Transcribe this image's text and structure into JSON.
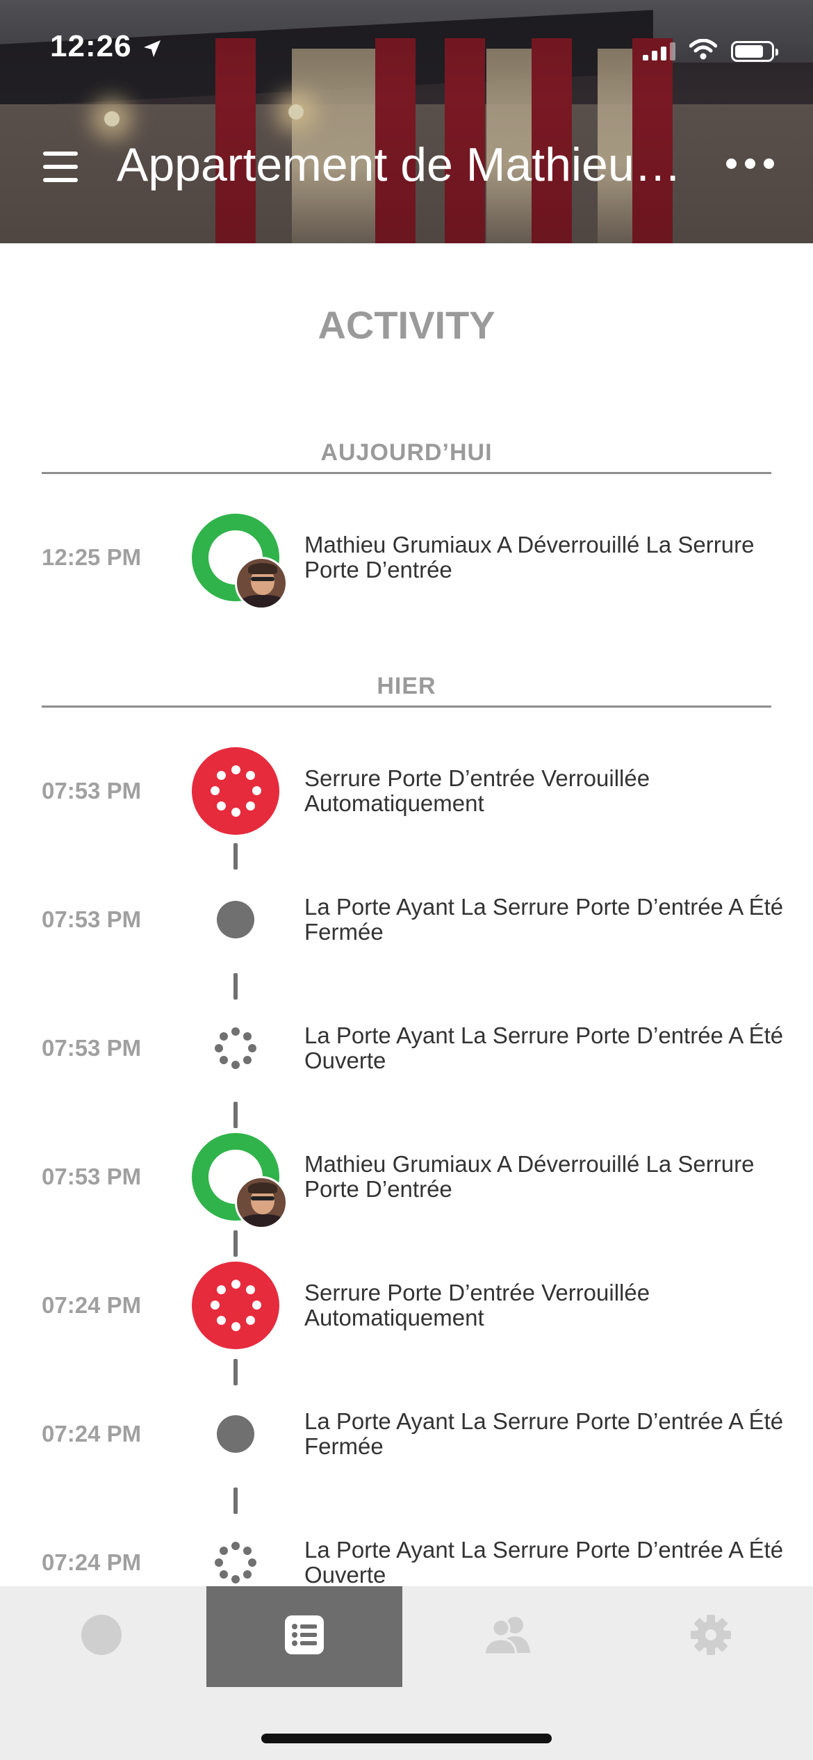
{
  "status_bar": {
    "time": "12:26"
  },
  "header": {
    "title": "Appartement de Mathieu…"
  },
  "page": {
    "title": "ACTIVITY"
  },
  "sections": [
    {
      "label": "AUJOURD’HUI",
      "items": [
        {
          "time": "12:25 PM",
          "icon": "unlock-user-icon",
          "text": "Mathieu Grumiaux A Déverrouillé La Serrure Porte D’entrée"
        }
      ]
    },
    {
      "label": "HIER",
      "items": [
        {
          "time": "07:53 PM",
          "icon": "auto-lock-icon",
          "text": "Serrure Porte D’entrée Verrouillée Automatiquement"
        },
        {
          "time": "07:53 PM",
          "icon": "door-closed-icon",
          "text": "La Porte Ayant La Serrure Porte D’entrée A Été Fermée"
        },
        {
          "time": "07:53 PM",
          "icon": "door-open-icon",
          "text": "La Porte Ayant La Serrure Porte D’entrée A Été Ouverte"
        },
        {
          "time": "07:53 PM",
          "icon": "unlock-user-icon",
          "text": "Mathieu Grumiaux A Déverrouillé La Serrure Porte D’entrée"
        },
        {
          "time": "07:24 PM",
          "icon": "auto-lock-icon",
          "text": "Serrure Porte D’entrée Verrouillée Automatiquement"
        },
        {
          "time": "07:24 PM",
          "icon": "door-closed-icon",
          "text": "La Porte Ayant La Serrure Porte D’entrée A Été Fermée"
        },
        {
          "time": "07:24 PM",
          "icon": "door-open-icon",
          "text": "La Porte Ayant La Serrure Porte D’entrée A Été Ouverte"
        }
      ]
    }
  ],
  "tabbar": {
    "tabs": [
      {
        "icon": "lock-status-icon",
        "active": false
      },
      {
        "icon": "activity-list-icon",
        "active": true
      },
      {
        "icon": "guests-icon",
        "active": false
      },
      {
        "icon": "settings-gear-icon",
        "active": false
      }
    ]
  },
  "colors": {
    "unlock_green": "#2fb34a",
    "lock_red": "#e62b3d",
    "event_gray": "#707070",
    "tab_active": "#6d6d6d"
  }
}
